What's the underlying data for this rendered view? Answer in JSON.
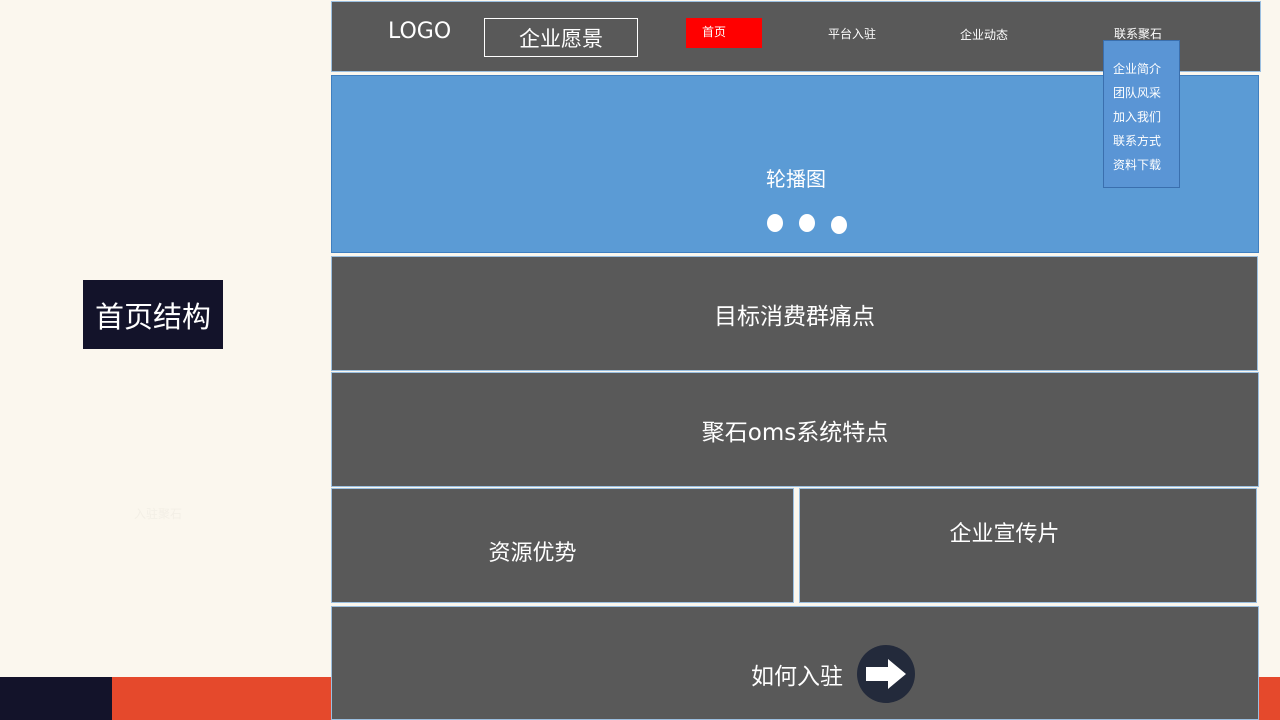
{
  "slide": {
    "title": "首页结构",
    "faint_text": "入驻聚石"
  },
  "header": {
    "logo": "LOGO",
    "vision_button": "企业愿景",
    "nav": {
      "home": "首页",
      "platform_join": "平台入驻",
      "company_news": "企业动态",
      "contact": "联系聚石"
    },
    "dropdown": [
      "企业简介",
      "团队风采",
      "加入我们",
      "联系方式",
      "资料下载"
    ]
  },
  "carousel": {
    "label": "轮播图",
    "dot_count": 3
  },
  "sections": {
    "pain_points": "目标消费群痛点",
    "oms_features": "聚石oms系统特点",
    "resources": "资源优势",
    "promo_video": "企业宣传片",
    "how_to_join": "如何入驻"
  },
  "icons": {
    "arrow": "arrow-right-icon"
  },
  "colors": {
    "block_gray": "#595959",
    "carousel_blue": "#5b9bd5",
    "nav_active": "#ff0000",
    "navy": "#13132a",
    "orange": "#e5492c",
    "background": "#fbf7ee"
  }
}
